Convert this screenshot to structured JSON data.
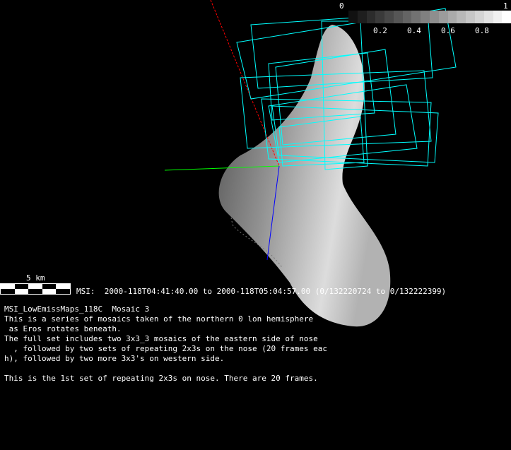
{
  "colorbar": {
    "min_label": "0",
    "max_label": "1",
    "ticks": [
      "0.2",
      "0.4",
      "0.6",
      "0.8"
    ],
    "frame_color": "#00ffff"
  },
  "scale_bar": {
    "label": "5 km"
  },
  "msi_line": "MSI:  2000-118T04:41:40.00 to 2000-118T05:04:57.00 (0/132220724 to 0/132222399)",
  "description": {
    "title": "MSI_LowEmissMaps_118C  Mosaic 3",
    "lines": [
      "This is a series of mosaics taken of the northern 0 lon hemisphere",
      " as Eros rotates beneath.",
      "The full set includes two 3x3_3 mosaics of the eastern side of nose",
      "  , followed by two sets of repeating 2x3s on the nose (20 frames eac",
      "h), followed by two more 3x3's on western side.",
      "",
      "This is the 1st set of repeating 2x3s on nose. There are 20 frames."
    ]
  },
  "axes_colors": {
    "x": "#ff0000",
    "y": "#00ff00",
    "z": "#0000ff"
  }
}
